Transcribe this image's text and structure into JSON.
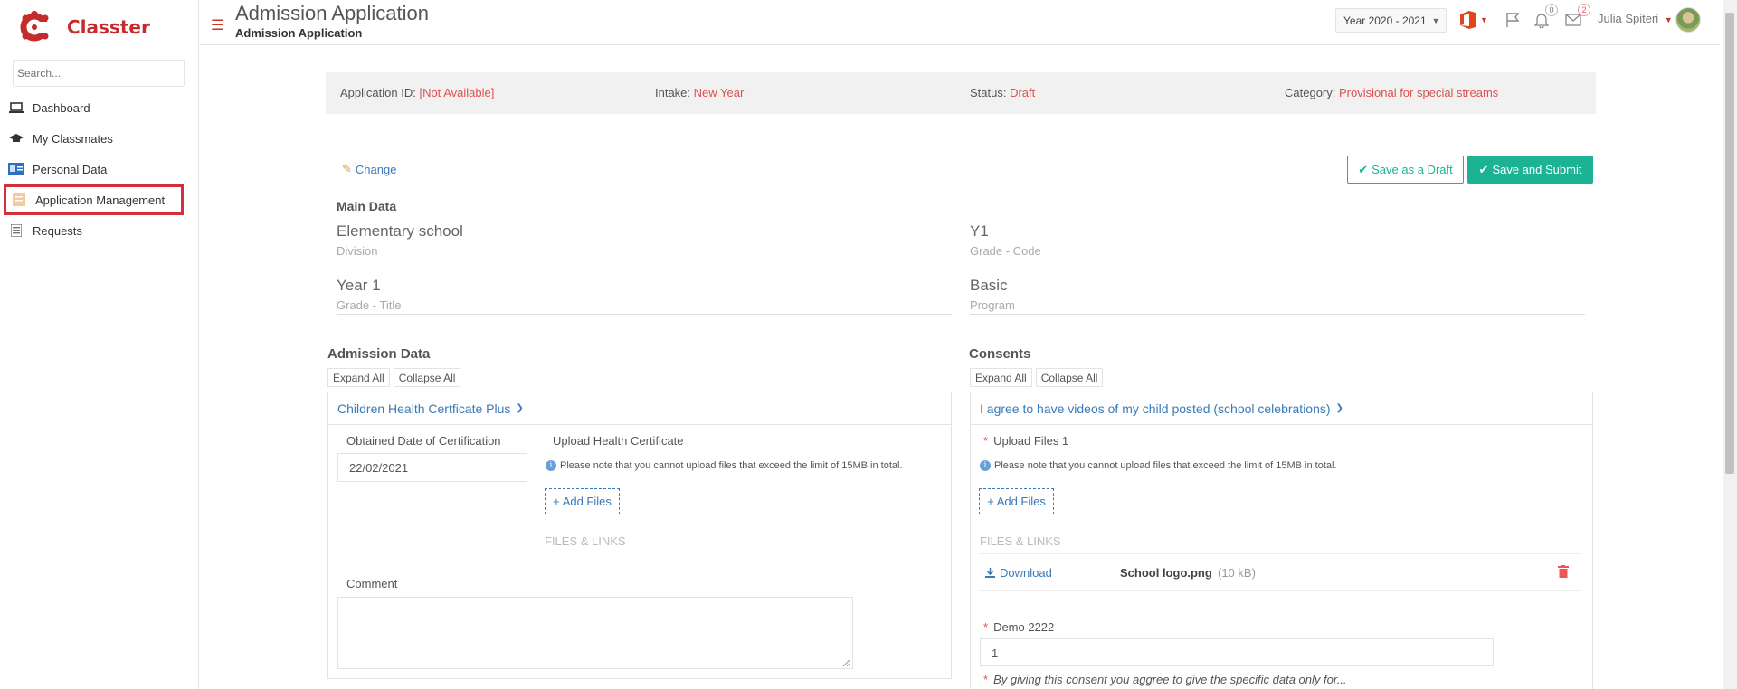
{
  "app": {
    "name": "Classter"
  },
  "sidebar": {
    "search_placeholder": "Search...",
    "items": [
      {
        "label": "Dashboard",
        "icon": "laptop-icon"
      },
      {
        "label": "My Classmates",
        "icon": "graduation-cap-icon"
      },
      {
        "label": "Personal Data",
        "icon": "id-card-icon"
      },
      {
        "label": "Application Management",
        "icon": "application-icon",
        "active": true
      },
      {
        "label": "Requests",
        "icon": "list-icon"
      }
    ]
  },
  "header": {
    "title": "Admission Application",
    "subtitle": "Admission Application",
    "year": "Year 2020 - 2021",
    "notifications_count": "0",
    "messages_count": "2",
    "user_name": "Julia Spiteri"
  },
  "info": {
    "app_id_label": "Application ID:",
    "app_id_value": "[Not Available]",
    "intake_label": "Intake:",
    "intake_value": "New Year",
    "status_label": "Status:",
    "status_value": "Draft",
    "category_label": "Category:",
    "category_value": "Provisional for special streams"
  },
  "actions": {
    "change": "Change",
    "save_draft": "Save as a Draft",
    "save_submit": "Save and Submit"
  },
  "main_data": {
    "title": "Main Data",
    "fields": [
      {
        "value": "Elementary school",
        "label": "Division"
      },
      {
        "value": "Y1",
        "label": "Grade - Code"
      },
      {
        "value": "Year 1",
        "label": "Grade - Title"
      },
      {
        "value": "Basic",
        "label": "Program"
      }
    ]
  },
  "admission": {
    "title": "Admission Data",
    "expand_all": "Expand All",
    "collapse_all": "Collapse All",
    "panel_title": "Children Health Certficate Plus",
    "obtained_date_label": "Obtained Date of Certification",
    "obtained_date_value": "22/02/2021",
    "upload_label": "Upload Health Certificate",
    "upload_note": "Please note that you cannot upload files that exceed the limit of 15MB in total.",
    "add_files": "Add Files",
    "files_links": "FILES & LINKS",
    "comment_label": "Comment"
  },
  "consents": {
    "title": "Consents",
    "expand_all": "Expand All",
    "collapse_all": "Collapse All",
    "panel_title": "I agree to have videos of my child posted (school celebrations)",
    "upload_label": "Upload Files 1",
    "upload_note": "Please note that you cannot upload files that exceed the limit of 15MB in total.",
    "add_files": "Add Files",
    "files_links": "FILES & LINKS",
    "download": "Download",
    "file_name": "School logo.png",
    "file_size": "(10 kB)",
    "demo_label": "Demo 2222",
    "demo_value": "1",
    "consent_note": "By giving this consent you aggree to give the specific data only for..."
  },
  "colors": {
    "brand": "#c62b2b",
    "accent": "#1bb394",
    "link": "#3a7ab8",
    "alert": "#d9534f"
  }
}
